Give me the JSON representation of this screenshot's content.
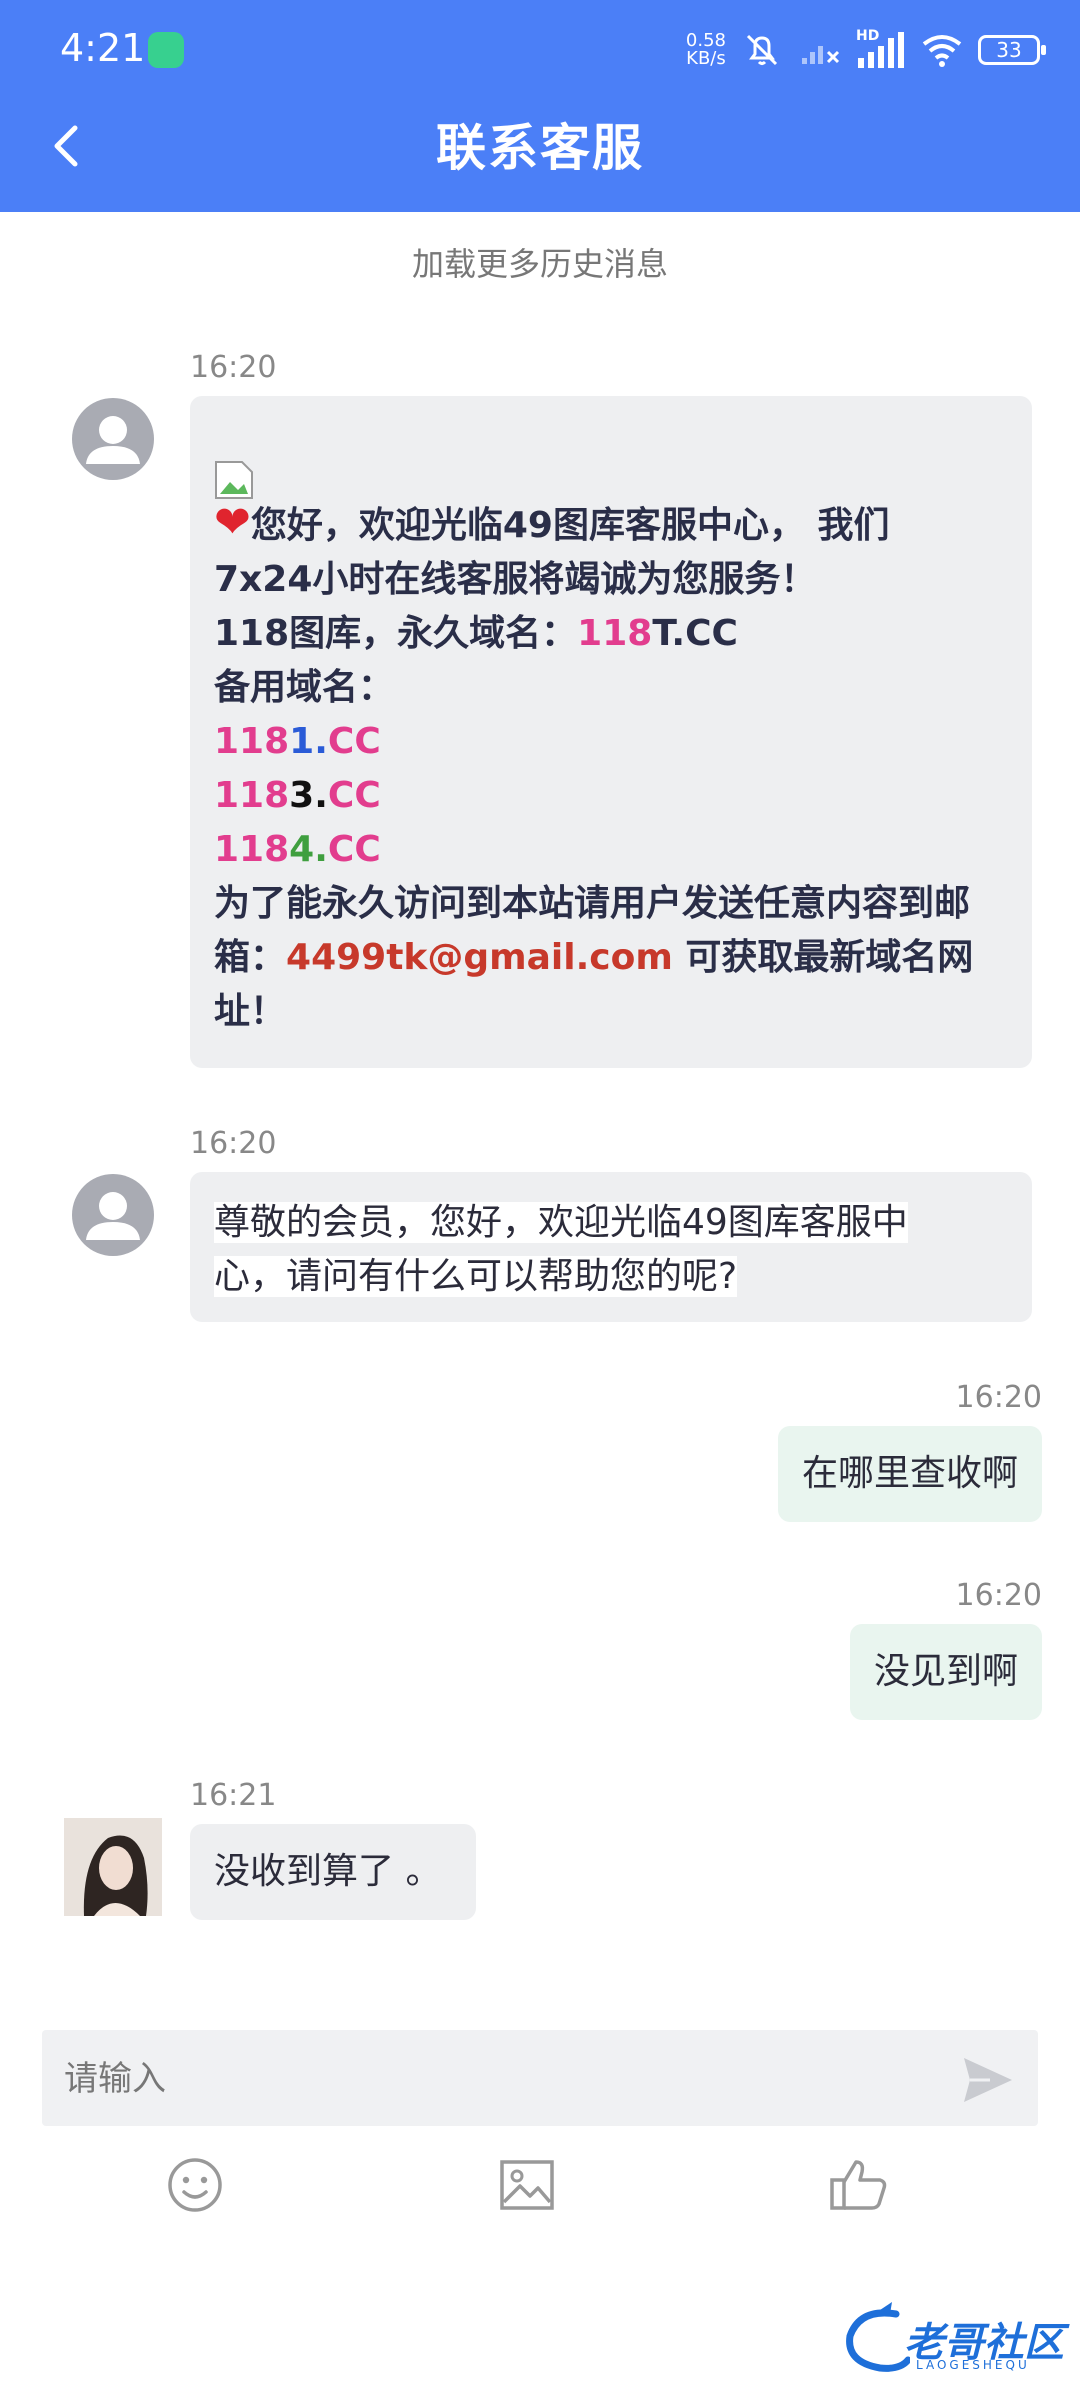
{
  "status_bar": {
    "time": "4:21",
    "net_speed_value": "0.58",
    "net_speed_unit": "KB/s",
    "hd_label": "HD",
    "battery": "33"
  },
  "header": {
    "title": "联系客服"
  },
  "history": {
    "load_more": "加载更多历史消息"
  },
  "messages": [
    {
      "time": "16:20",
      "side": "left",
      "lines": {
        "l1": "您好，欢迎光临49图库客服中心， 我们",
        "l2": "7x24小时在线客服将竭诚为您服务！",
        "l3_prefix": "118图库，永久域名：",
        "l3_num": "118",
        "l3_suffix": "T.CC",
        "l4": "备用域名：",
        "d1_num": "118",
        "d1_digit": "1",
        "d1_dot": ".",
        "d1_tld": "CC",
        "d2_num": "118",
        "d2_digit": "3",
        "d2_dot": ".",
        "d2_tld": "CC",
        "d3_num": "118",
        "d3_digit": "4",
        "d3_dot": ".",
        "d3_tld": "CC",
        "l8": "为了能永久访问到本站请用户发送任意内容到邮",
        "l9_prefix": "箱：",
        "email": "4499tk@gmail.com",
        "l9_suffix": " 可获取最新域名网",
        "l10": "址！"
      }
    },
    {
      "time": "16:20",
      "side": "left",
      "line1": "尊敬的会员，您好，欢迎光临49图库客服中",
      "line2": "心，请问有什么可以帮助您的呢?"
    },
    {
      "time": "16:20",
      "side": "right",
      "text": "在哪里查收啊"
    },
    {
      "time": "16:20",
      "side": "right",
      "text": "没见到啊"
    },
    {
      "time": "16:21",
      "side": "left",
      "text": "没收到算了 。"
    }
  ],
  "input": {
    "placeholder": "请输入"
  },
  "toolbar": [
    "emoji-icon",
    "image-icon",
    "thumbs-up-icon"
  ],
  "watermark": {
    "text": "老哥社区",
    "sub": "LAOGESHEQU"
  },
  "colors": {
    "header_bg": "#4b7ff7",
    "bubble_in": "#eeeff1",
    "bubble_out": "#e9f5ef",
    "domain_pink": "#e23d8e",
    "email_red": "#c7392b"
  }
}
